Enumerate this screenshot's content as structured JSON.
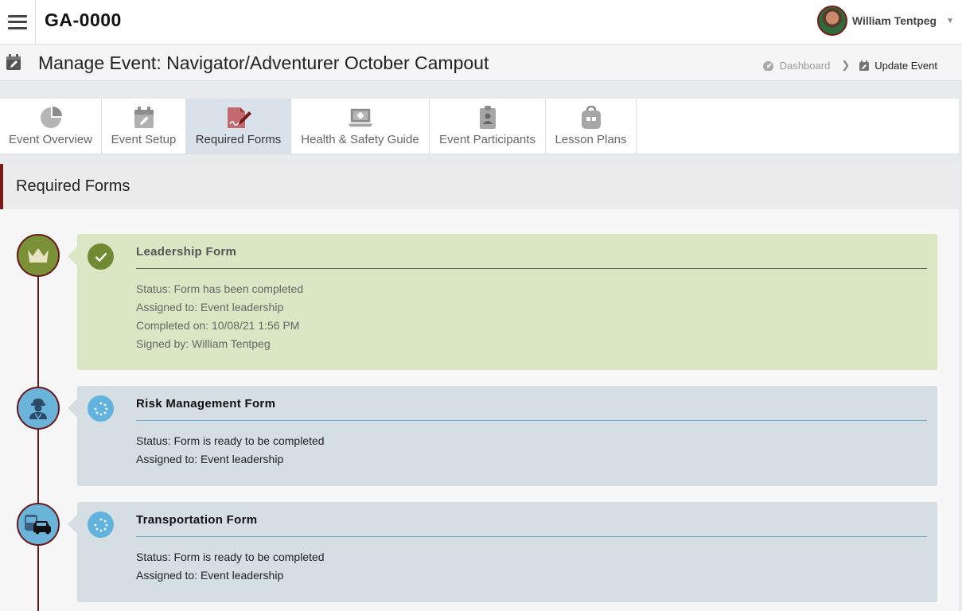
{
  "header": {
    "unit_code": "GA-0000",
    "user_name": "William Tentpeg"
  },
  "page": {
    "title": "Manage Event: Navigator/Adventurer October Campout",
    "breadcrumb": {
      "dashboard": "Dashboard",
      "current": "Update Event"
    }
  },
  "tabs": [
    {
      "label": "Event Overview",
      "icon": "pie-chart-icon"
    },
    {
      "label": "Event Setup",
      "icon": "calendar-edit-icon"
    },
    {
      "label": "Required Forms",
      "icon": "signed-form-icon",
      "active": true
    },
    {
      "label": "Health & Safety Guide",
      "icon": "first-aid-laptop-icon"
    },
    {
      "label": "Event Participants",
      "icon": "clipboard-person-icon"
    },
    {
      "label": "Lesson Plans",
      "icon": "backpack-icon"
    }
  ],
  "section": {
    "title": "Required Forms"
  },
  "forms": [
    {
      "title": "Leadership Form",
      "state": "done",
      "icon": "crown-icon",
      "status_icon": "checkmark-icon",
      "lines": {
        "status": "Status: Form has been completed",
        "assigned": "Assigned to: Event leadership",
        "completed": "Completed on: 10/08/21 1:56 PM",
        "signed": "Signed by: William Tentpeg"
      }
    },
    {
      "title": "Risk Management Form",
      "state": "pending",
      "icon": "safety-worker-icon",
      "status_icon": "spinner-icon",
      "lines": {
        "status": "Status: Form is ready to be completed",
        "assigned": "Assigned to: Event leadership"
      }
    },
    {
      "title": "Transportation Form",
      "state": "pending",
      "icon": "bus-car-icon",
      "status_icon": "spinner-icon",
      "lines": {
        "status": "Status: Form is ready to be completed",
        "assigned": "Assigned to: Event leadership"
      }
    }
  ],
  "colors": {
    "accent": "#7a1a1a",
    "done_card": "#dbe6c4",
    "pending_card": "#d4dee3",
    "done_node": "#7a9137",
    "pending_node": "#6ab4da",
    "active_tab": "#d9e2ea"
  }
}
